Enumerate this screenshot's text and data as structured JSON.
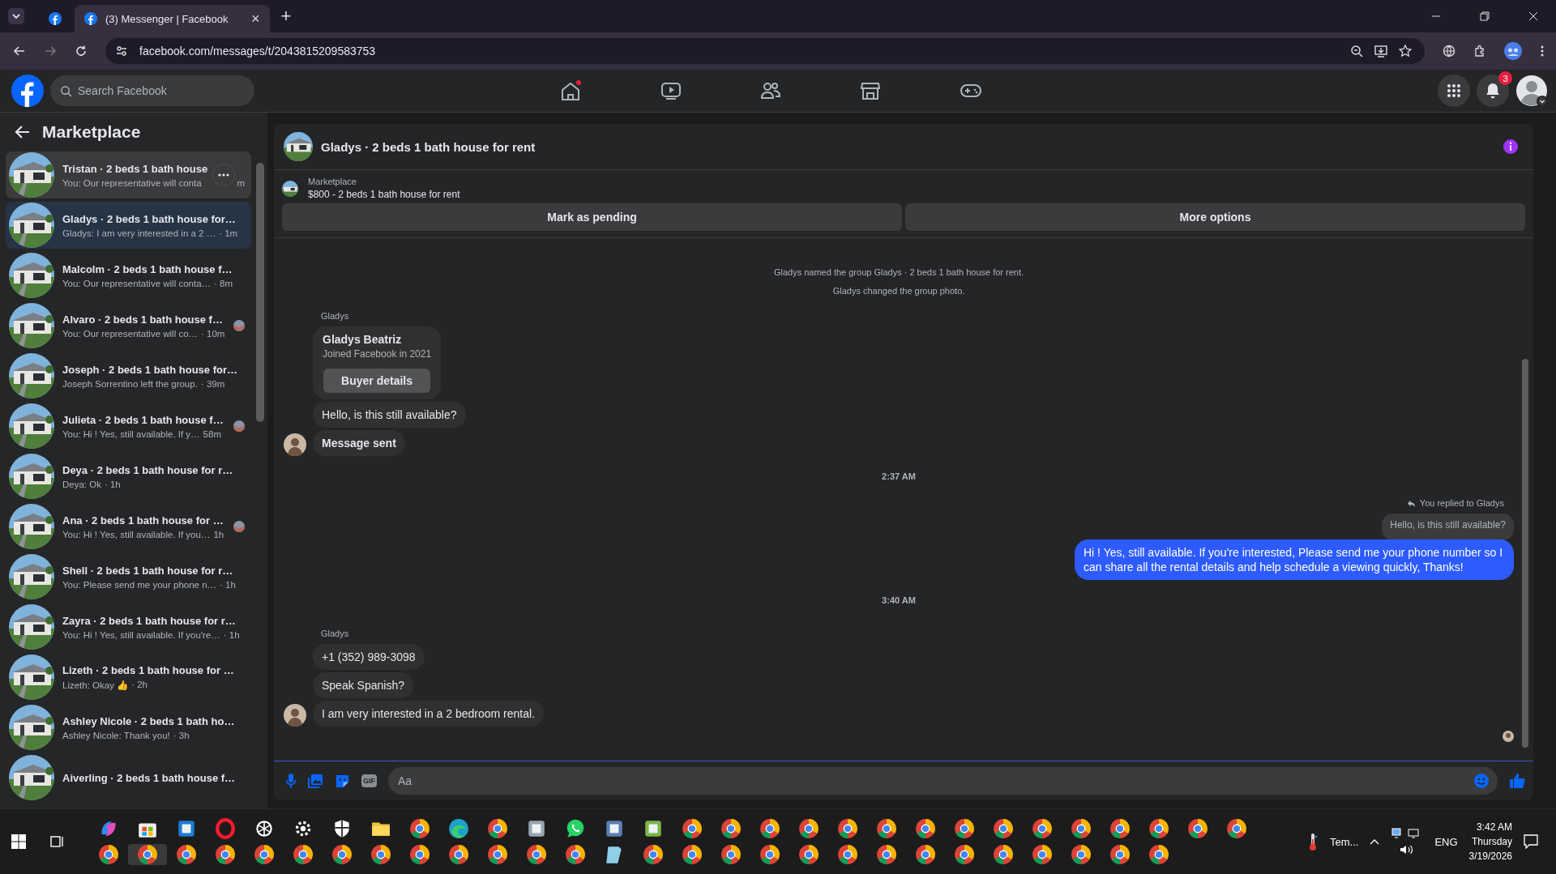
{
  "browser": {
    "tabs": [
      {
        "selected": false
      },
      {
        "title": "(3) Messenger | Facebook",
        "selected": true
      }
    ],
    "close_glyph": "×",
    "new_tab_glyph": "+",
    "url": "facebook.com/messages/t/2043815209583753"
  },
  "topbar": {
    "search_placeholder": "Search Facebook",
    "notification_count": "3"
  },
  "sidebar": {
    "title": "Marketplace",
    "conversations": [
      {
        "title": "Tristan · 2 beds 1 bath house",
        "preview": "You: Our representative will conta",
        "time": "m",
        "selected": false,
        "hovered": true
      },
      {
        "title": "Gladys · 2 beds 1 bath house for…",
        "preview": "Gladys: I am very interested in a 2 …",
        "time": "· 1m",
        "selected": true,
        "hovered": false
      },
      {
        "title": "Malcolm · 2 beds 1 bath house f…",
        "preview": "You: Our representative will conta…",
        "time": "· 8m",
        "selected": false,
        "hovered": false
      },
      {
        "title": "Alvaro · 2 beds 1 bath house f…",
        "preview": "You: Our representative will co…",
        "time": "· 10m",
        "selected": false,
        "hovered": false,
        "seen": true
      },
      {
        "title": "Joseph · 2 beds 1 bath house for…",
        "preview": "Joseph Sorrentino left the group.",
        "time": "· 39m",
        "selected": false,
        "hovered": false
      },
      {
        "title": "Julieta · 2 beds 1 bath house f…",
        "preview": "You: Hi ! Yes, still available. If y…",
        "time": "58m",
        "selected": false,
        "hovered": false,
        "seen": true
      },
      {
        "title": "Deya · 2 beds 1 bath house for r…",
        "preview": "Deya: Ok",
        "time": "· 1h",
        "selected": false,
        "hovered": false
      },
      {
        "title": "Ana · 2 beds 1 bath house for …",
        "preview": "You: Hi ! Yes, still available. If you…",
        "time": "1h",
        "selected": false,
        "hovered": false,
        "seen": true
      },
      {
        "title": "Shell · 2 beds 1 bath house for r…",
        "preview": "You: Please send me your phone n…",
        "time": "· 1h",
        "selected": false,
        "hovered": false
      },
      {
        "title": "Zayra · 2 beds 1 bath house for r…",
        "preview": "You: Hi ! Yes, still available. If you're…",
        "time": "· 1h",
        "selected": false,
        "hovered": false
      },
      {
        "title": "Lizeth · 2 beds 1 bath house for …",
        "preview": "Lizeth: Okay 👍",
        "time": "· 2h",
        "selected": false,
        "hovered": false
      },
      {
        "title": "Ashley Nicole · 2 beds 1 bath ho…",
        "preview": "Ashley Nicole: Thank you!",
        "time": "· 3h",
        "selected": false,
        "hovered": false
      },
      {
        "title": "Aiverling · 2 beds 1 bath house f…",
        "selected": false,
        "hovered": false
      }
    ]
  },
  "chat": {
    "title": "Gladys · 2 beds 1 bath house for rent",
    "listing_label": "Marketplace",
    "listing_title": "$800 - 2 beds 1 bath house for rent",
    "actions": [
      "Mark as pending",
      "More options"
    ],
    "messages": [
      {
        "kind": "system",
        "text": "Gladys named the group Gladys · 2 beds 1 bath house for rent."
      },
      {
        "kind": "system",
        "text": "Gladys changed the group photo."
      },
      {
        "kind": "sender",
        "text": "Gladys"
      },
      {
        "kind": "profile_card",
        "name": "Gladys Beatriz",
        "subtitle": "Joined Facebook in 2021",
        "button": "Buyer details"
      },
      {
        "kind": "incoming",
        "text": "Hello, is this still available?",
        "avatar": false,
        "bold": false
      },
      {
        "kind": "incoming",
        "text": "Message sent",
        "avatar": true,
        "bold": true
      },
      {
        "kind": "timestamp",
        "text": "2:37 AM"
      },
      {
        "kind": "reply_note",
        "text": "You replied to Gladys"
      },
      {
        "kind": "quoted",
        "text": "Hello, is this still available?"
      },
      {
        "kind": "outgoing",
        "text": "Hi ! Yes, still available. If you're interested, Please send me your phone number so I can share all the rental details and help schedule a viewing quickly, Thanks!"
      },
      {
        "kind": "timestamp",
        "text": "3:40 AM"
      },
      {
        "kind": "sender",
        "text": "Gladys"
      },
      {
        "kind": "incoming",
        "text": "+1 (352) 989-3098",
        "avatar": false,
        "bold": false
      },
      {
        "kind": "incoming",
        "text": "Speak Spanish?",
        "avatar": false,
        "bold": false
      },
      {
        "kind": "incoming",
        "text": "I am very interested in a 2 bedroom rental.",
        "avatar": true,
        "bold": false
      }
    ],
    "composer": {
      "placeholder": "Aa",
      "gif_label": "GIF"
    }
  },
  "taskbar": {
    "weather": "Tem...",
    "language": "ENG",
    "time": "3:42 AM",
    "day": "Thursday",
    "date": "3/19/2026"
  }
}
